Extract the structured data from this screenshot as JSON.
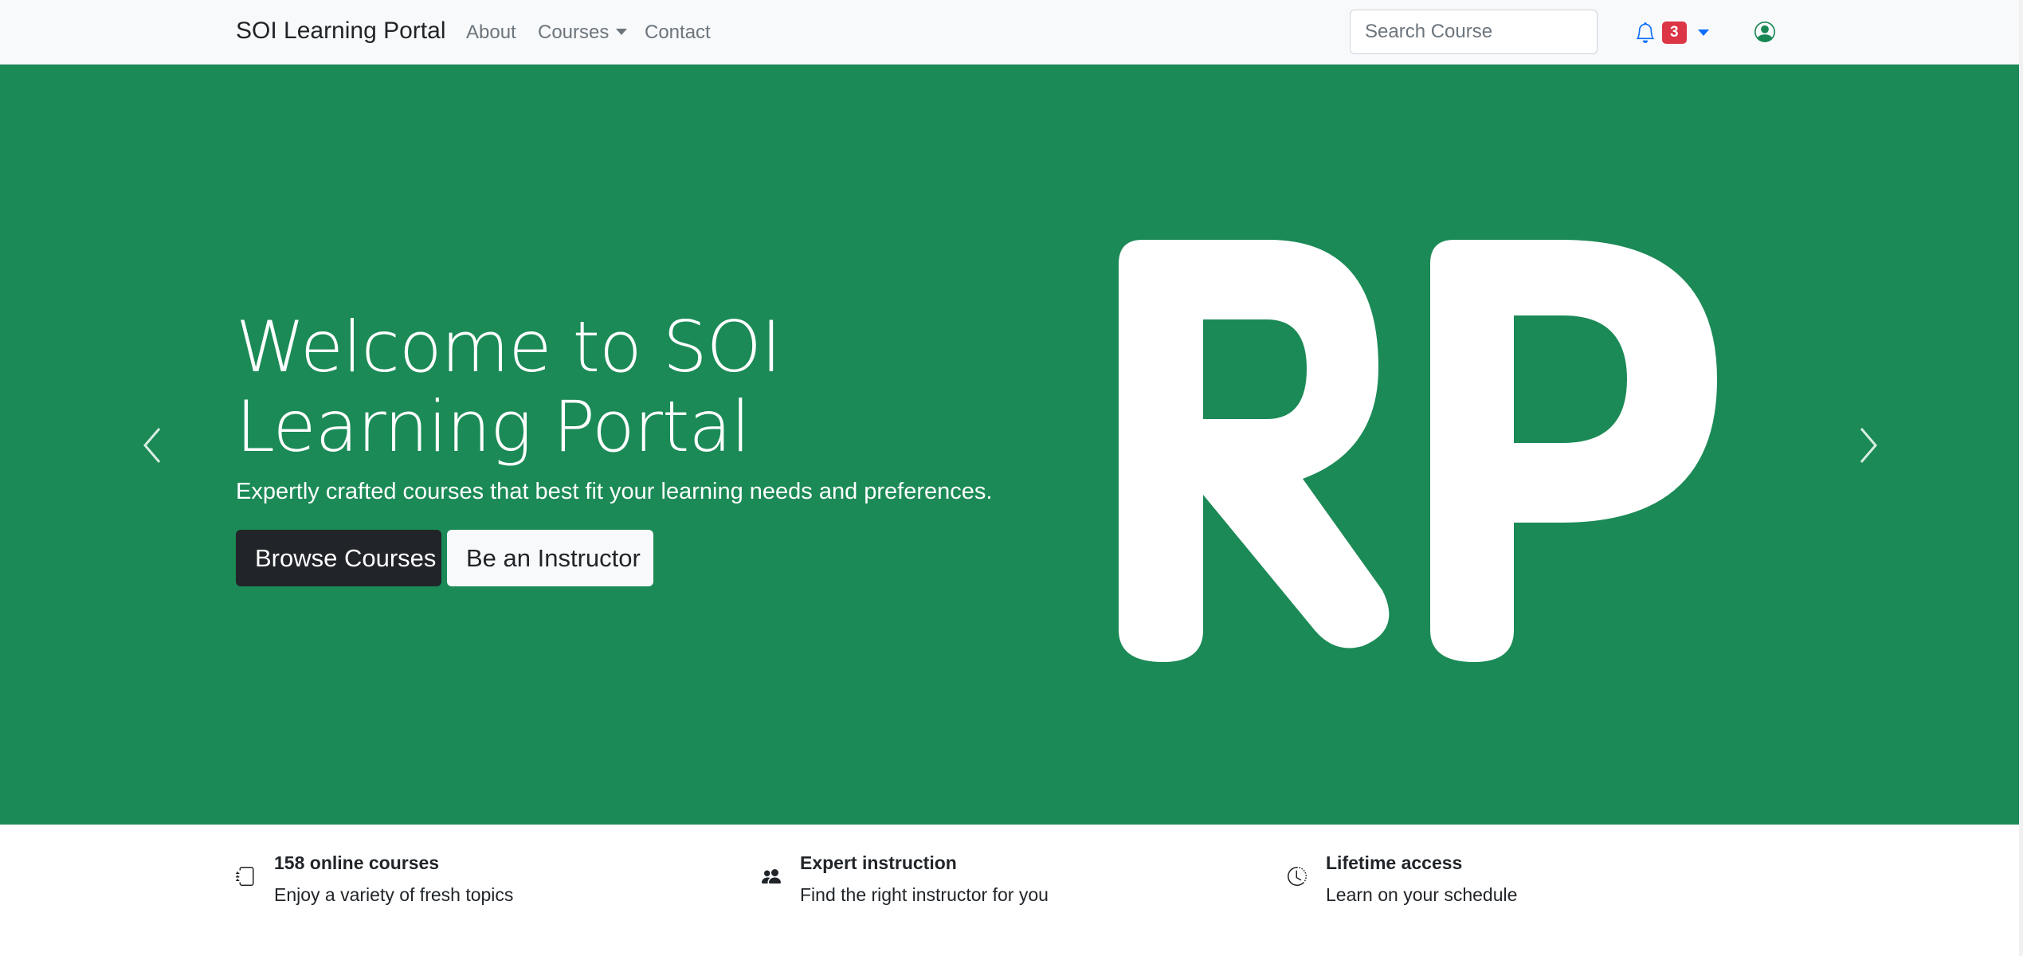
{
  "navbar": {
    "brand": "SOI Learning Portal",
    "links": {
      "about": "About",
      "courses": "Courses",
      "contact": "Contact"
    },
    "search_placeholder": "Search Course",
    "notification_count": "3"
  },
  "hero": {
    "title": "Welcome to SOI Learning Portal",
    "subtitle": "Expertly crafted courses that best fit your learning needs and preferences.",
    "primary_button": "Browse Courses",
    "secondary_button": "Be an Instructor",
    "logo_text": "RP",
    "background_color": "#1b8a56"
  },
  "features": [
    {
      "icon": "book-icon",
      "title": "158 online courses",
      "text": "Enjoy a variety of fresh topics"
    },
    {
      "icon": "people-icon",
      "title": "Expert instruction",
      "text": "Find the right instructor for you"
    },
    {
      "icon": "clock-icon",
      "title": "Lifetime access",
      "text": "Learn on your schedule"
    }
  ],
  "colors": {
    "danger": "#dc3545",
    "primary": "#0d6efd",
    "dark": "#212529",
    "user_icon": "#198754"
  }
}
